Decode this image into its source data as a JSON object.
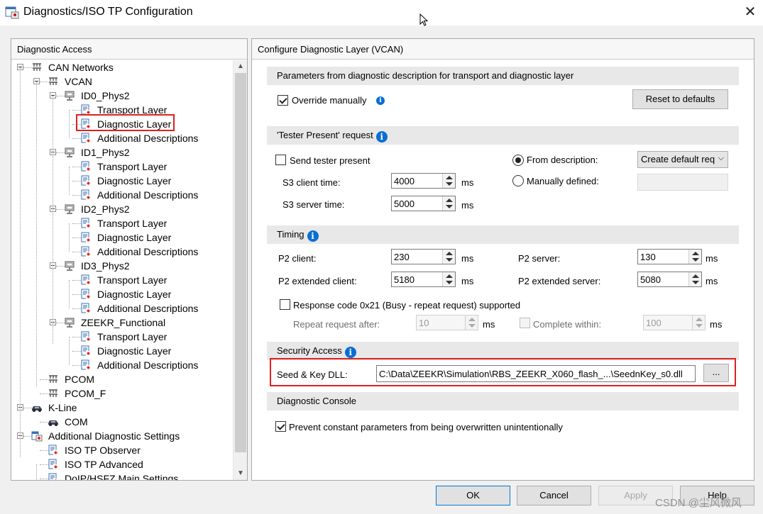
{
  "window": {
    "title": "Diagnostics/ISO TP Configuration"
  },
  "left": {
    "header": "Diagnostic Access",
    "tree": {
      "can_networks": "CAN Networks",
      "vcan": "VCAN",
      "id0": "ID0_Phys2",
      "id1": "ID1_Phys2",
      "id2": "ID2_Phys2",
      "id3": "ID3_Phys2",
      "zeekr": "ZEEKR_Functional",
      "transport_layer": "Transport Layer",
      "diagnostic_layer": "Diagnostic Layer",
      "additional_descriptions": "Additional Descriptions",
      "pcom": "PCOM",
      "pcom_f": "PCOM_F",
      "kline": "K-Line",
      "com": "COM",
      "additional_settings": "Additional Diagnostic Settings",
      "iso_tp_observer": "ISO TP Observer",
      "iso_tp_advanced": "ISO TP Advanced",
      "doip": "DoIP/HSFZ Main Settings"
    }
  },
  "right": {
    "header": "Configure Diagnostic Layer (VCAN)",
    "params": {
      "title": "Parameters from diagnostic description for transport and diagnostic layer",
      "override_label": "Override manually",
      "override_checked": true,
      "reset_button": "Reset to defaults"
    },
    "tester": {
      "title": "'Tester Present' request",
      "send_label": "Send tester present",
      "send_checked": false,
      "s3_client_label": "S3 client time:",
      "s3_client_value": "4000",
      "s3_server_label": "S3 server time:",
      "s3_server_value": "5000",
      "unit": "ms",
      "from_desc_label": "From description:",
      "manual_label": "Manually defined:",
      "combo_value": "Create default req"
    },
    "timing": {
      "title": "Timing",
      "p2_client_label": "P2 client:",
      "p2_client_value": "230",
      "p2_ext_client_label": "P2 extended client:",
      "p2_ext_client_value": "5180",
      "p2_server_label": "P2 server:",
      "p2_server_value": "130",
      "p2_ext_server_label": "P2 extended server:",
      "p2_ext_server_value": "5080",
      "unit": "ms",
      "busy_label": "Response code 0x21 (Busy - repeat request) supported",
      "busy_checked": false,
      "repeat_label": "Repeat request after:",
      "repeat_value": "10",
      "complete_label": "Complete within:",
      "complete_value": "100"
    },
    "security": {
      "title": "Security Access",
      "dll_label": "Seed & Key DLL:",
      "dll_path": "C:\\Data\\ZEEKR\\Simulation\\RBS_ZEEKR_X060_flash_...\\SeednKey_s0.dll",
      "browse": "..."
    },
    "console": {
      "title": "Diagnostic Console",
      "prevent_label": "Prevent constant parameters from being overwritten unintentionally",
      "prevent_checked": true
    }
  },
  "buttons": {
    "ok": "OK",
    "cancel": "Cancel",
    "apply": "Apply",
    "help": "Help"
  },
  "watermark": "CSDN @尘风微风",
  "colors": {
    "highlight": "#e02020",
    "accent": "#0078d7",
    "info": "#0a6ed1"
  }
}
